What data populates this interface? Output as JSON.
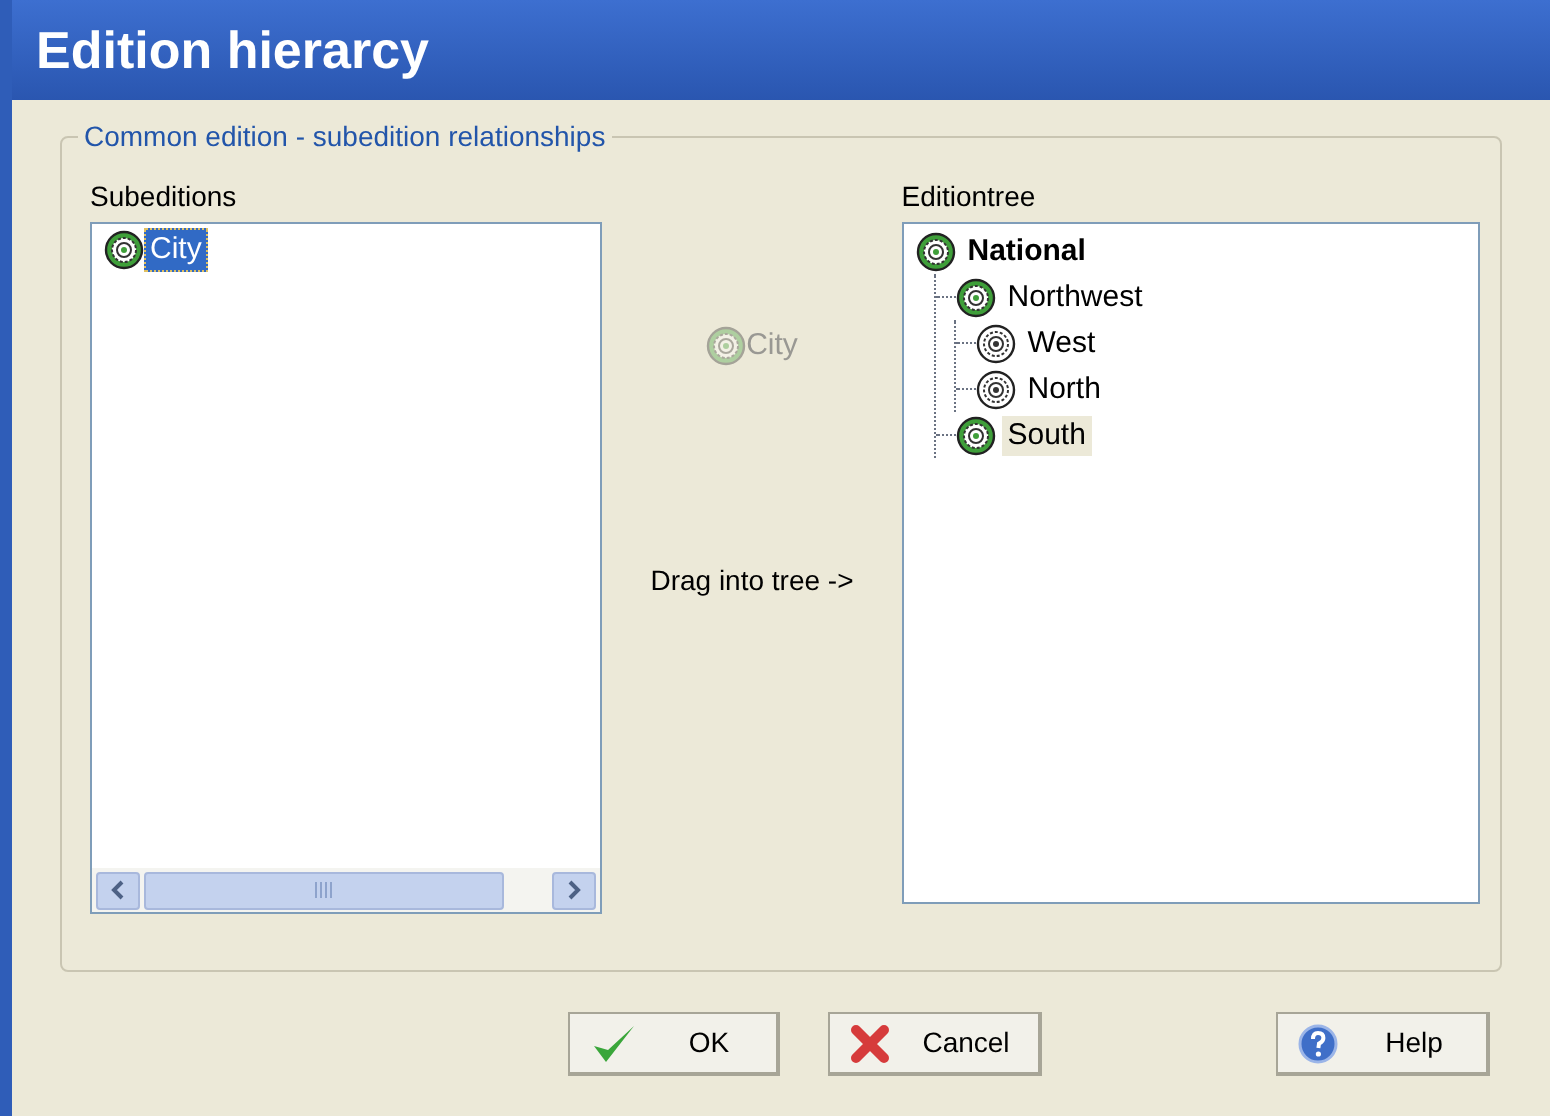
{
  "window": {
    "title": "Edition hierarcy"
  },
  "group": {
    "title": "Common edition - subedition relationships"
  },
  "subeditions": {
    "label": "Subeditions",
    "items": [
      {
        "label": "City",
        "selected": true,
        "active": true
      }
    ]
  },
  "drag_preview": {
    "label": "City"
  },
  "drag_hint": "Drag into tree ->",
  "editiontree": {
    "label": "Editiontree",
    "items": [
      {
        "label": "National",
        "bold": true,
        "active": true,
        "selected": false,
        "children": [
          {
            "label": "Northwest",
            "bold": false,
            "active": true,
            "selected": false,
            "children": [
              {
                "label": "West",
                "bold": false,
                "active": false,
                "selected": false
              },
              {
                "label": "North",
                "bold": false,
                "active": false,
                "selected": false
              }
            ]
          },
          {
            "label": "South",
            "bold": false,
            "active": true,
            "selected": true
          }
        ]
      }
    ]
  },
  "buttons": [
    {
      "label": "OK",
      "kind": "ok"
    },
    {
      "label": "Cancel",
      "kind": "cancel"
    },
    {
      "label": "Help",
      "kind": "help"
    }
  ]
}
